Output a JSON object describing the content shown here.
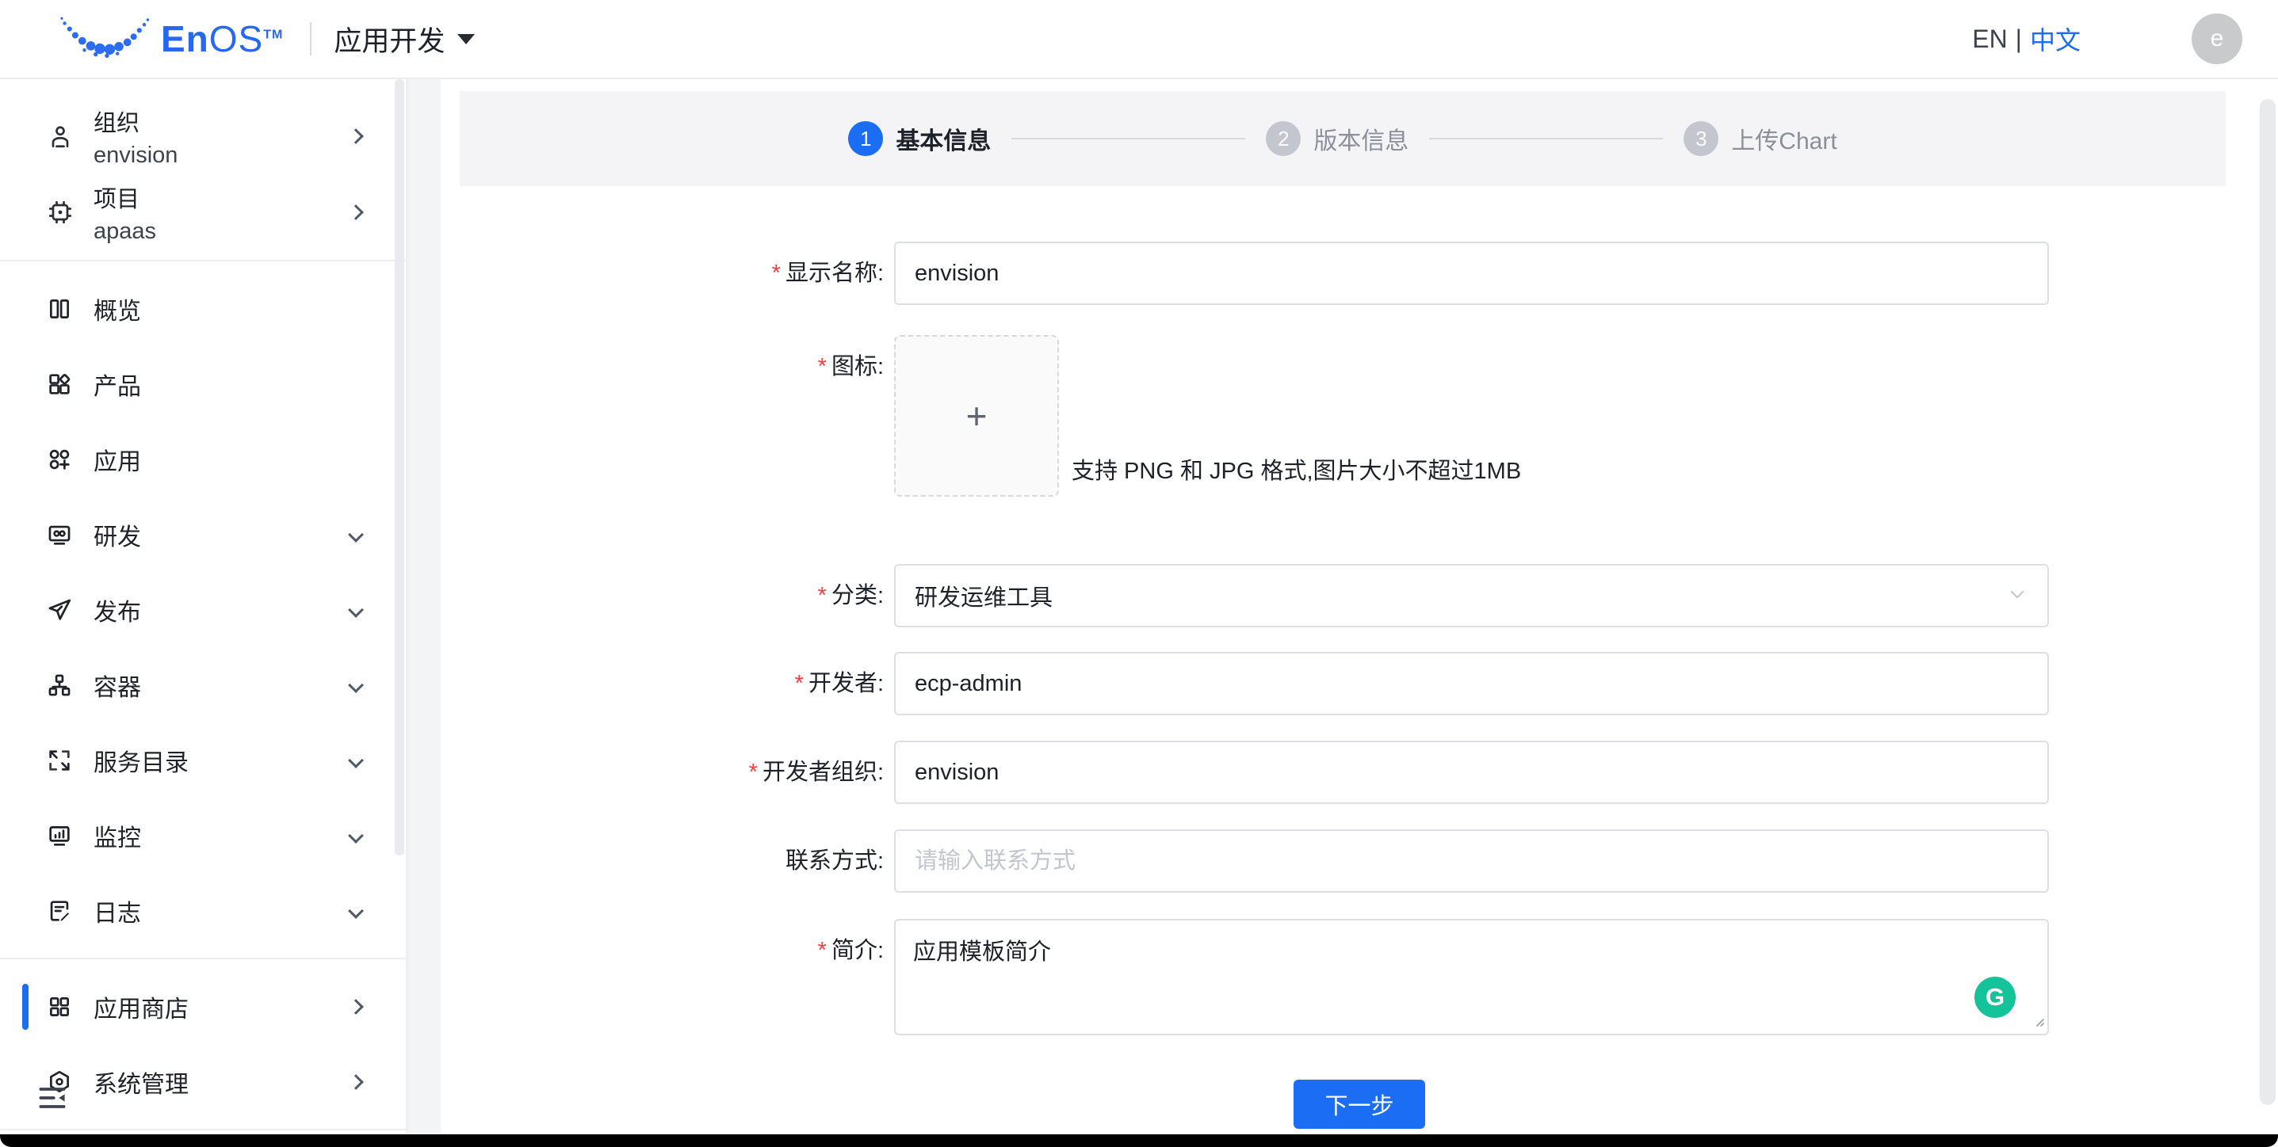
{
  "colors": {
    "accent_blue": "#1b6ef3",
    "required_red": "#f53f3f",
    "grammarly_green": "#15c39a",
    "step_inactive_gray": "#c3c6cf"
  },
  "header": {
    "brand": {
      "name_bold": "En",
      "name_light": "OS",
      "tm": "TM"
    },
    "app_title": "应用开发",
    "lang": {
      "en": "EN",
      "divider": "|",
      "zh": "中文"
    },
    "avatar_letter": "e"
  },
  "sidebar": {
    "context": [
      {
        "label": "组织",
        "value": "envision"
      },
      {
        "label": "项目",
        "value": "apaas"
      }
    ],
    "items": [
      {
        "label": "概览"
      },
      {
        "label": "产品"
      },
      {
        "label": "应用"
      },
      {
        "label": "研发"
      },
      {
        "label": "发布"
      },
      {
        "label": "容器"
      },
      {
        "label": "服务目录"
      },
      {
        "label": "监控"
      },
      {
        "label": "日志"
      },
      {
        "label": "应用商店"
      },
      {
        "label": "系统管理"
      }
    ]
  },
  "stepper": {
    "steps": [
      {
        "num": "1",
        "label": "基本信息"
      },
      {
        "num": "2",
        "label": "版本信息"
      },
      {
        "num": "3",
        "label": "上传Chart"
      }
    ]
  },
  "form": {
    "required_mark": "*",
    "display_name": {
      "label": "显示名称:",
      "value": "envision"
    },
    "icon": {
      "label": "图标:",
      "plus": "+",
      "hint": "支持 PNG 和 JPG 格式,图片大小不超过1MB"
    },
    "category": {
      "label": "分类:",
      "value": "研发运维工具"
    },
    "developer": {
      "label": "开发者:",
      "value": "ecp-admin"
    },
    "developer_org": {
      "label": "开发者组织:",
      "value": "envision"
    },
    "contact": {
      "label": "联系方式:",
      "placeholder": "请输入联系方式"
    },
    "intro": {
      "label": "简介:",
      "value": "应用模板简介",
      "grammarly_letter": "G"
    }
  },
  "actions": {
    "next": "下一步"
  }
}
